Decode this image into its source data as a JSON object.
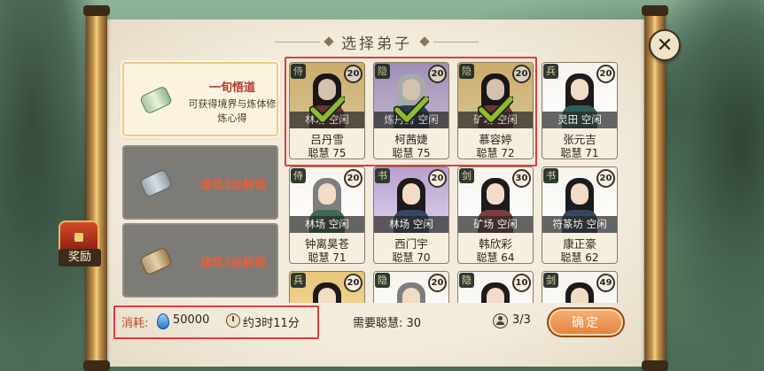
{
  "title": "选择弟子",
  "reward": {
    "label": "奖励"
  },
  "tasks": [
    {
      "name": "一旬悟道",
      "desc": "可获得境界与炼体修炼心得",
      "state": "active"
    },
    {
      "lock_text": "建筑2级解锁",
      "state": "locked"
    },
    {
      "lock_text": "建筑3级解锁",
      "state": "locked"
    }
  ],
  "disciples": [
    {
      "name": "吕丹雪",
      "status": "林场 空闲",
      "wisdom": "聪慧 75",
      "level": "20",
      "type": "侍",
      "frame": "gold",
      "selected": true
    },
    {
      "name": "柯茜婕",
      "status": "炼丹房 空闲",
      "wisdom": "聪慧 75",
      "level": "20",
      "type": "隐",
      "frame": "purple",
      "selected": true
    },
    {
      "name": "慕容婷",
      "status": "矿场 空闲",
      "wisdom": "聪慧 72",
      "level": "20",
      "type": "隐",
      "frame": "gold",
      "selected": true
    },
    {
      "name": "张元吉",
      "status": "灵田 空闲",
      "wisdom": "聪慧 71",
      "level": "20",
      "type": "兵",
      "frame": "white",
      "selected": false
    },
    {
      "name": "钟离昊苍",
      "status": "林场 空闲",
      "wisdom": "聪慧 71",
      "level": "20",
      "type": "侍",
      "frame": "white",
      "selected": false
    },
    {
      "name": "西门宇",
      "status": "林场 空闲",
      "wisdom": "聪慧 70",
      "level": "20",
      "type": "书",
      "frame": "purple",
      "selected": false
    },
    {
      "name": "韩欣彩",
      "status": "矿场 空闲",
      "wisdom": "聪慧 64",
      "level": "30",
      "type": "剑",
      "frame": "white",
      "selected": false
    },
    {
      "name": "康正豪",
      "status": "符篆坊 空闲",
      "wisdom": "聪慧 62",
      "level": "20",
      "type": "书",
      "frame": "white",
      "selected": false
    },
    {
      "name": "",
      "status": "",
      "wisdom": "",
      "level": "20",
      "type": "兵",
      "frame": "gold",
      "selected": false
    },
    {
      "name": "",
      "status": "",
      "wisdom": "",
      "level": "20",
      "type": "隐",
      "frame": "white",
      "selected": false
    },
    {
      "name": "",
      "status": "",
      "wisdom": "",
      "level": "10",
      "type": "隐",
      "frame": "white",
      "selected": false
    },
    {
      "name": "",
      "status": "",
      "wisdom": "",
      "level": "49",
      "type": "剑",
      "frame": "white",
      "selected": false
    }
  ],
  "footer": {
    "cost_label": "消耗:",
    "cost_value": "50000",
    "time_value": "约3时11分",
    "need_label": "需要聪慧: 30",
    "count_value": "3/3",
    "confirm_label": "确定"
  },
  "colors": {
    "highlight_red": "#e63a3a",
    "confirm_orange": "#e2813b",
    "lock_text": "#e0623d",
    "task_title": "#b4392a"
  },
  "icons": {
    "close": "close-icon",
    "gem": "spirit-stone-icon",
    "clock": "clock-icon",
    "person": "person-icon",
    "check": "check-icon",
    "chest": "treasure-chest-icon"
  }
}
